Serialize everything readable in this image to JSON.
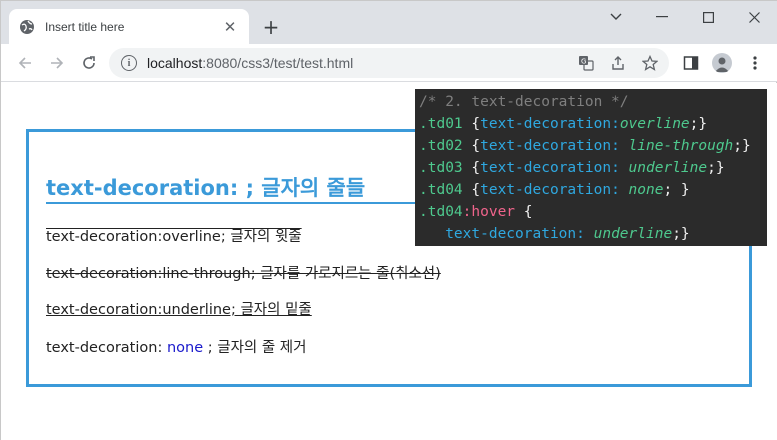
{
  "browser": {
    "tab_title": "Insert title here",
    "tab_close": "✕",
    "new_tab": "+",
    "url_host": "localhost",
    "url_path": ":8080/css3/test/test.html"
  },
  "page": {
    "heading": "text-decoration: ; 글자의 줄들",
    "rows": [
      "text-decoration:overline; 글자의 윗줄",
      "text-decoration:line-through; 글자를 가로지르는 줄(취소선)",
      "text-decoration:underline; 글자의 밑줄"
    ],
    "row4_prefix": "text-decoration: ",
    "row4_keyword": "none",
    "row4_suffix": " ; 글자의 줄 제거"
  },
  "code": {
    "comment": "/* 2. text-decoration */",
    "lines": [
      {
        "sel": ".td01",
        "open": " {",
        "prop": "text-decoration:",
        "val": "overline",
        "close": ";}"
      },
      {
        "sel": ".td02",
        "open": " {",
        "prop": "text-decoration: ",
        "val": "line-through",
        "close": ";}"
      },
      {
        "sel": ".td03",
        "open": " {",
        "prop": "text-decoration: ",
        "val": "underline",
        "close": ";}"
      },
      {
        "sel": ".td04",
        "open": " {",
        "prop": "text-decoration: ",
        "val": "none",
        "close": "; }"
      }
    ],
    "hover_sel": ".td04",
    "hover_pseudo": ":hover",
    "hover_open": " {",
    "hover_prop": "   text-decoration: ",
    "hover_val": "underline",
    "hover_close": ";}"
  },
  "colors": {
    "accent": "#3b9ad9",
    "code_bg": "#2b2b2b",
    "none_keyword": "#1a1acc"
  }
}
